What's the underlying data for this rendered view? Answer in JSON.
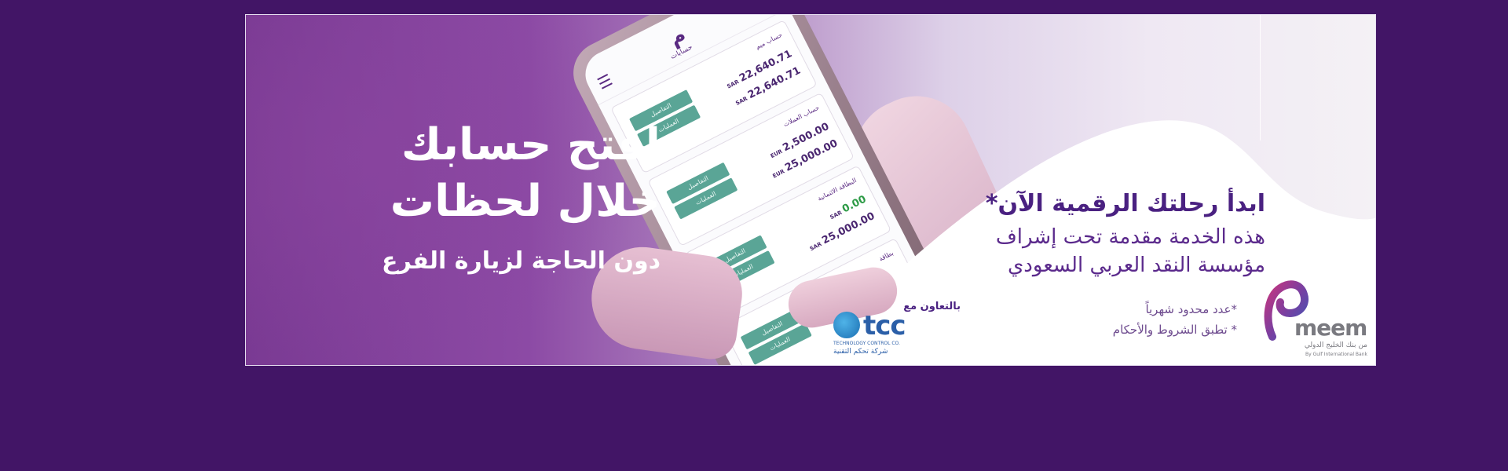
{
  "banner": {
    "headline_line1": "افتح حسابك",
    "headline_line2": "خلال لحظات",
    "subline": "دون الحاجة لزيارة الفرع",
    "journey": "ابدأ رحلتك الرقمية الآن*",
    "service_line1": "هذه الخدمة مقدمة تحت إشراف",
    "service_line2": "مؤسسة النقد العربي السعودي",
    "note1": "*عدد محدود شهرياً",
    "note2": "* تطبق الشروط والأحكام",
    "collab_label": "بالتعاون مع"
  },
  "partner": {
    "name": "tcc",
    "english_name": "TECHNOLOGY CONTROL CO.",
    "arabic_name": "شركة تحكم التقنية"
  },
  "brand": {
    "name": "meem",
    "arabic_tagline": "من بنك الخليج الدولي",
    "english_tagline": "By Gulf International Bank"
  },
  "phone_app": {
    "title": "حسابات",
    "logo": "meem",
    "accounts": [
      {
        "name": "حساب ميم",
        "amount1": "22,640.71",
        "amount2": "22,640.71",
        "currency": "SAR",
        "btn1": "التفاصيل",
        "btn2": "العمليات"
      },
      {
        "name": "حساب العملات",
        "amount1": "2,500.00",
        "amount2": "25,000.00",
        "currency": "EUR",
        "btn1": "التفاصيل",
        "btn2": "العمليات"
      },
      {
        "name": "البطاقة الائتمانية",
        "amount1": "0.00",
        "amount2": "25,000.00",
        "currency": "SAR",
        "btn1": "التفاصيل",
        "btn2": "العمليات"
      },
      {
        "name": "بطاقة",
        "amount1": "",
        "amount2": "",
        "currency": "",
        "btn1": "التفاصيل",
        "btn2": "العمليات"
      }
    ]
  },
  "colors": {
    "page_bg": "#421566",
    "brand_purple": "#4a2181",
    "accent_teal": "#5aa596"
  }
}
